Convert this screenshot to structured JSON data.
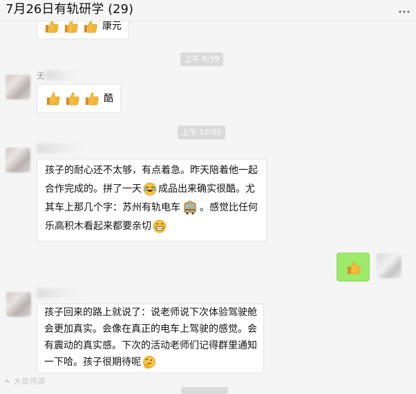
{
  "header": {
    "title": "7月26日有轨研学 (29)",
    "more_icon": "ellipsis-icon"
  },
  "messages": {
    "top_partial": {
      "text": "康元"
    },
    "time1": "上午 9:59",
    "msg1": {
      "sender_char": "无",
      "text": "酷"
    },
    "time2": "上午 10:05",
    "msg2": {
      "line1": "孩子的耐心还不太够，有点着急。昨天陪着他一起",
      "line2_a": "合作完成的。拼了一天",
      "line2_b": "成品出来确实很酷。尤",
      "line3_a": "其车上那几个字：苏州有轨电车",
      "line3_b": "。感觉比任何",
      "line4": "乐高积木看起来都要亲切"
    },
    "msg4": {
      "line1": "孩子回来的路上就说了：说老师说下次体验驾驶舱",
      "line2": "会更加真实。会像在真正的电车上驾驶的感觉。会",
      "line3": "有震动的真实感。下次的活动老师们记得群里通知",
      "line4": "一下哈。孩子很期待呢"
    }
  },
  "watermark": "大故鸡湖",
  "colors": {
    "bubble_self": "#9eea6a",
    "bubble_other": "#ffffff",
    "time_pill": "#dadada"
  }
}
